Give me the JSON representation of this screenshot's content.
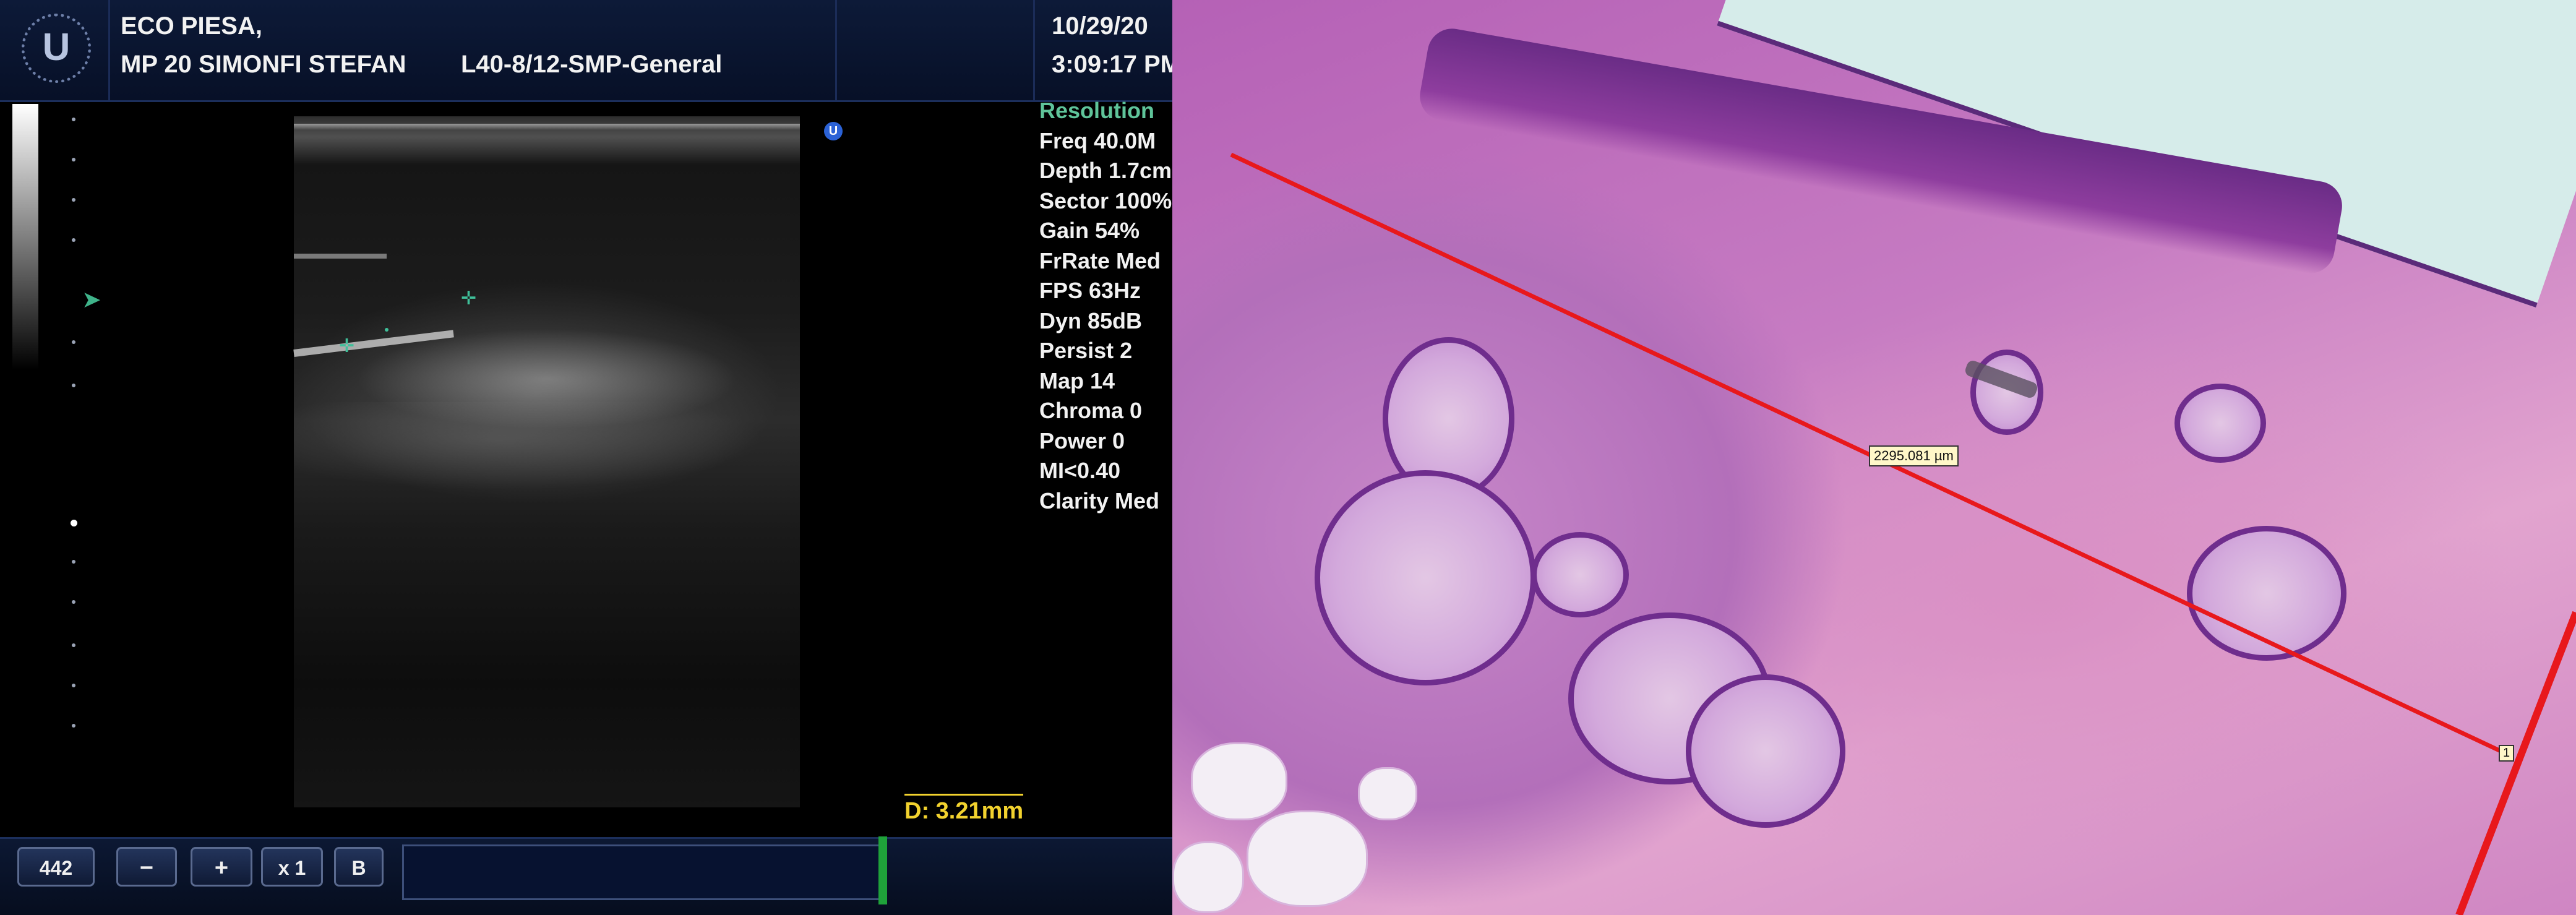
{
  "ultrasound": {
    "logo": "U",
    "header": {
      "patient_name": "ECO PIESA,",
      "operator": "MP 20 SIMONFI STEFAN",
      "probe_preset": "L40-8/12-SMP-General",
      "date": "10/29/20",
      "time": "3:09:17 PM"
    },
    "orientation_marker": "U",
    "parameters": [
      "Resolution",
      "Freq 40.0M",
      "Depth 1.7cm",
      "Sector 100%",
      "Gain 54%",
      "FrRate Med",
      "FPS 63Hz",
      "Dyn 85dB",
      "Persist 2",
      "Map 14",
      "Chroma 0",
      "Power 0",
      "MI<0.40",
      "Clarity Med"
    ],
    "measurement": "D: 3.21mm",
    "toolbar": {
      "frame_count": "442",
      "minus": "−",
      "plus": "+",
      "zoom": "x 1",
      "mode": "B"
    },
    "colors": {
      "header_bg": "#0d1a38",
      "param_highlight": "#5fc49a",
      "measure": "#f2d22e",
      "caliper": "#3fc09a",
      "cine_indicator": "#1fa23a"
    }
  },
  "histology": {
    "measurement_label": "2295.081 µm",
    "endpoint_label": "1",
    "colors": {
      "measure_line": "#e8181c",
      "label_bg": "#fff7c8"
    }
  }
}
